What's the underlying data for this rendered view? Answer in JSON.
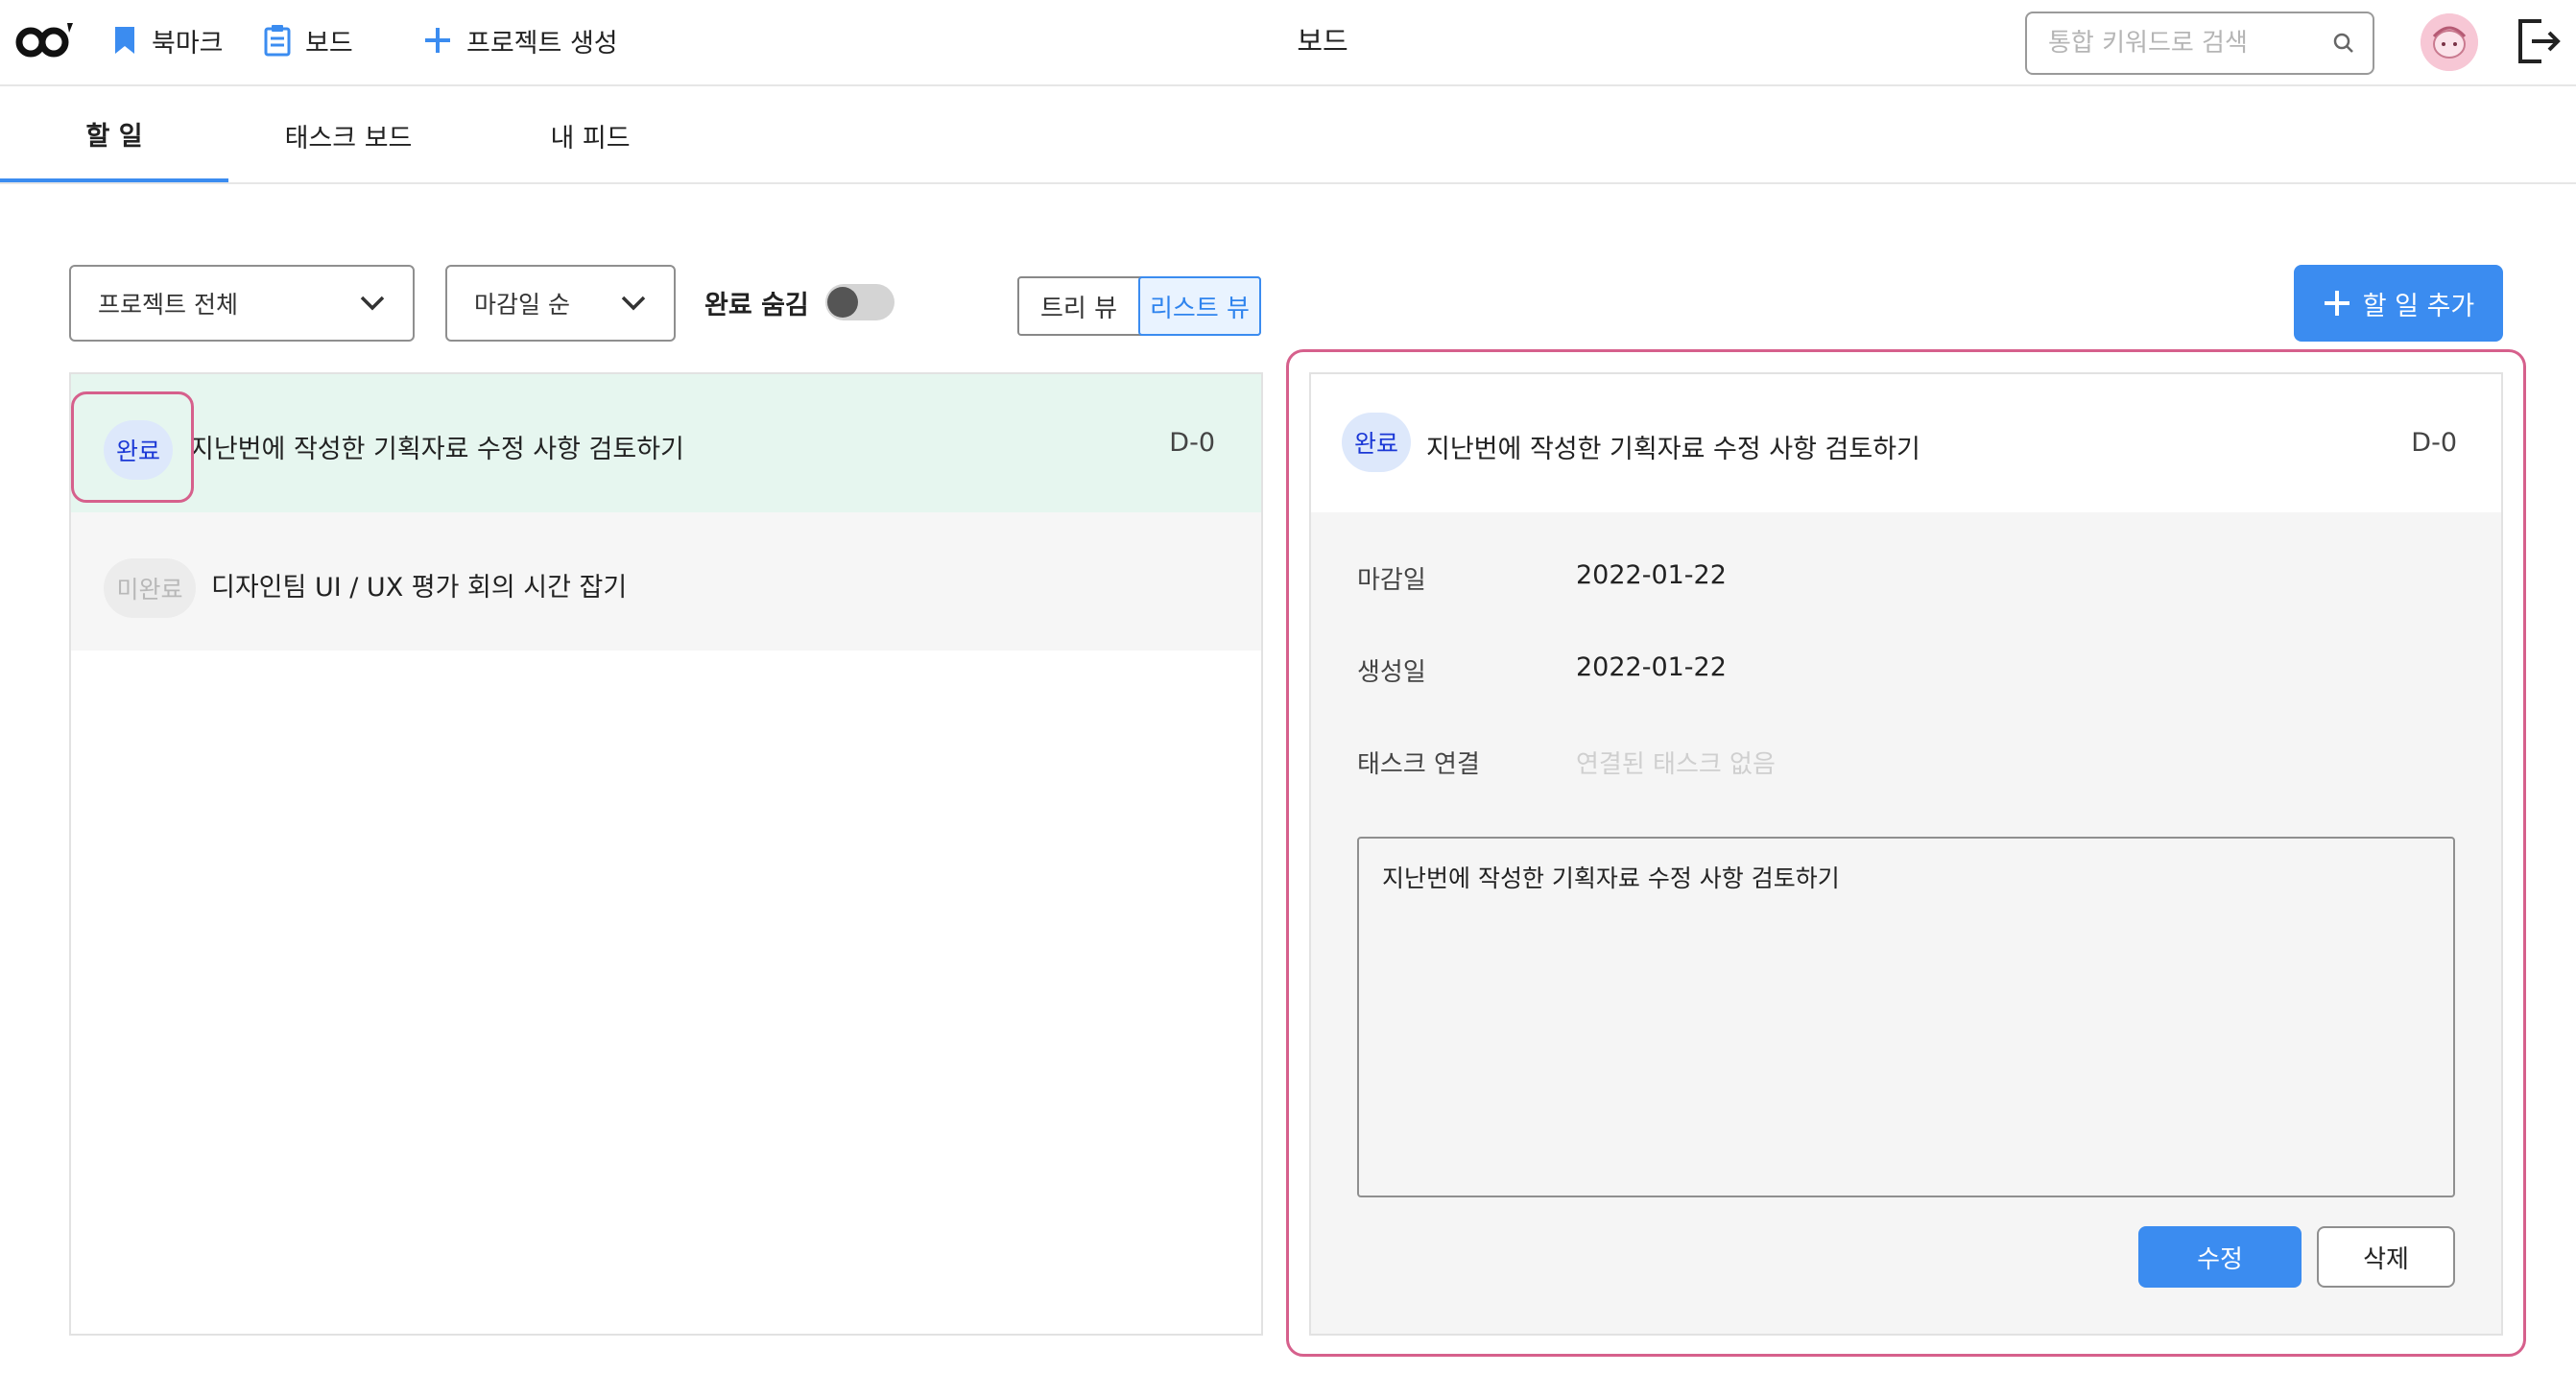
{
  "header": {
    "logo_icon": "co-logo-icon",
    "nav": [
      {
        "label": "북마크",
        "icon": "bookmark-icon"
      },
      {
        "label": "보드",
        "icon": "clipboard-icon"
      },
      {
        "label": "프로젝트 생성",
        "icon": "plus-icon"
      }
    ],
    "title": "보드",
    "search": {
      "placeholder": "통합 키워드로 검색",
      "value": ""
    },
    "accent_color": "#3b8cf0"
  },
  "tabs": [
    {
      "label": "할 일",
      "active": true
    },
    {
      "label": "태스크 보드",
      "active": false
    },
    {
      "label": "내 피드",
      "active": false
    }
  ],
  "toolbar": {
    "project_filter": "프로젝트 전체",
    "sort": "마감일 순",
    "hide_done_label": "완료 숨김",
    "hide_done": false,
    "views": [
      {
        "label": "트리 뷰",
        "active": false
      },
      {
        "label": "리스트 뷰",
        "active": true
      }
    ],
    "add_label": "할 일 추가"
  },
  "todos": [
    {
      "status": "완료",
      "title": "지난번에 작성한 기획자료 수정 사항 검토하기",
      "dday": "D-0",
      "done": true
    },
    {
      "status": "미완료",
      "title": "디자인팀 UI / UX 평가 회의 시간 잡기",
      "dday": "",
      "done": false
    }
  ],
  "detail": {
    "status": "완료",
    "title": "지난번에 작성한 기획자료 수정 사항 검토하기",
    "dday": "D-0",
    "fields": [
      {
        "label": "마감일",
        "value": "2022-01-22"
      },
      {
        "label": "생성일",
        "value": "2022-01-22"
      },
      {
        "label": "태스크 연결",
        "value": "연결된 태스크 없음"
      }
    ],
    "memo": "지난번에 작성한 기획자료 수정 사항 검토하기",
    "edit_label": "수정",
    "delete_label": "삭제"
  },
  "highlight_color": "#d6608c"
}
